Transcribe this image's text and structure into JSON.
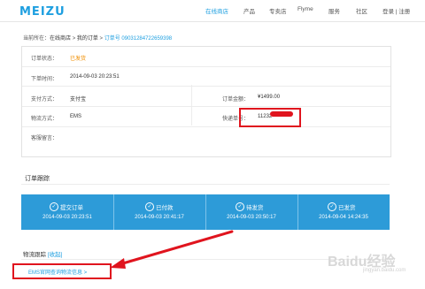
{
  "header": {
    "logo": "MEIZU",
    "nav": [
      "在线商店",
      "产品",
      "专卖店",
      "Flyme",
      "服务",
      "社区"
    ],
    "login": "登录 | 注册"
  },
  "breadcrumb": {
    "prefix": "当前所在：",
    "home": "在线商店",
    "sep1": " > ",
    "orders": "我的订单",
    "sep2": " > ",
    "current": "订单号 09031284722659398"
  },
  "order_info": {
    "status_label": "订单状态：",
    "status_value": "已发货",
    "order_time_label": "下单时间：",
    "order_time_value": "2014-09-03 20:23:51",
    "payment_label": "支付方式：",
    "payment_value": "支付宝",
    "amount_label": "订单金额：",
    "amount_value": "¥1499.00",
    "shipping_label": "物流方式：",
    "shipping_value": "EMS",
    "tracking_label": "快递单号：",
    "tracking_value": "11232",
    "message_label": "客服留言："
  },
  "tracking_section": {
    "title": "订单跟踪",
    "steps": [
      {
        "name": "提交订单",
        "time": "2014-09-03 20:23:51"
      },
      {
        "name": "已付款",
        "time": "2014-09-03 20:41:17"
      },
      {
        "name": "待发货",
        "time": "2014-09-03 20:50:17"
      },
      {
        "name": "已发货",
        "time": "2014-09-04 14:24:35"
      }
    ],
    "check_glyph": "✓"
  },
  "logistics": {
    "title": "物流跟踪",
    "collapse": "[收起]",
    "ems_link": "EMS官网查询物流信息 >"
  },
  "watermark": {
    "brand": "Baidu经验",
    "url": "jingyan.baidu.com"
  },
  "colors": {
    "accent": "#1e9fe0",
    "status_orange": "#f08e00",
    "highlight_red": "#e0141e",
    "step_bar": "#2d9bd8"
  }
}
